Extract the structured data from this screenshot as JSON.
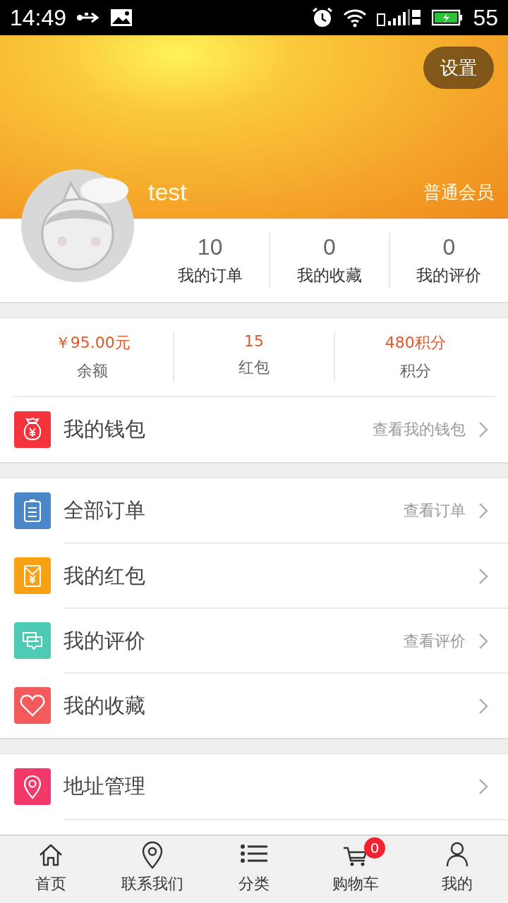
{
  "status_bar": {
    "time": "14:49",
    "battery": "55"
  },
  "header": {
    "settings_button": "设置",
    "username": "test",
    "member_level": "普通会员"
  },
  "stats": [
    {
      "value": "10",
      "label": "我的订单"
    },
    {
      "value": "0",
      "label": "我的收藏"
    },
    {
      "value": "0",
      "label": "我的评价"
    }
  ],
  "balances": [
    {
      "value": "￥95.00元",
      "label": "余额"
    },
    {
      "value": "15",
      "label": "红包"
    },
    {
      "value": "480积分",
      "label": "积分"
    }
  ],
  "groups": [
    {
      "items": [
        {
          "color": "#f5333a",
          "label": "我的钱包",
          "hint": "查看我的钱包"
        }
      ]
    },
    {
      "items": [
        {
          "color": "#4a86c8",
          "label": "全部订单",
          "hint": "查看订单"
        },
        {
          "color": "#f7a113",
          "label": "我的红包"
        },
        {
          "color": "#4ecab5",
          "label": "我的评价",
          "hint": "查看评价"
        },
        {
          "color": "#f35a5c",
          "label": "我的收藏"
        }
      ]
    },
    {
      "items": [
        {
          "color": "#f3386a",
          "label": "地址管理"
        }
      ]
    }
  ],
  "tab_bar": [
    {
      "label": "首页"
    },
    {
      "label": "联系我们"
    },
    {
      "label": "分类"
    },
    {
      "label": "购物车",
      "badge": "0"
    },
    {
      "label": "我的"
    }
  ]
}
